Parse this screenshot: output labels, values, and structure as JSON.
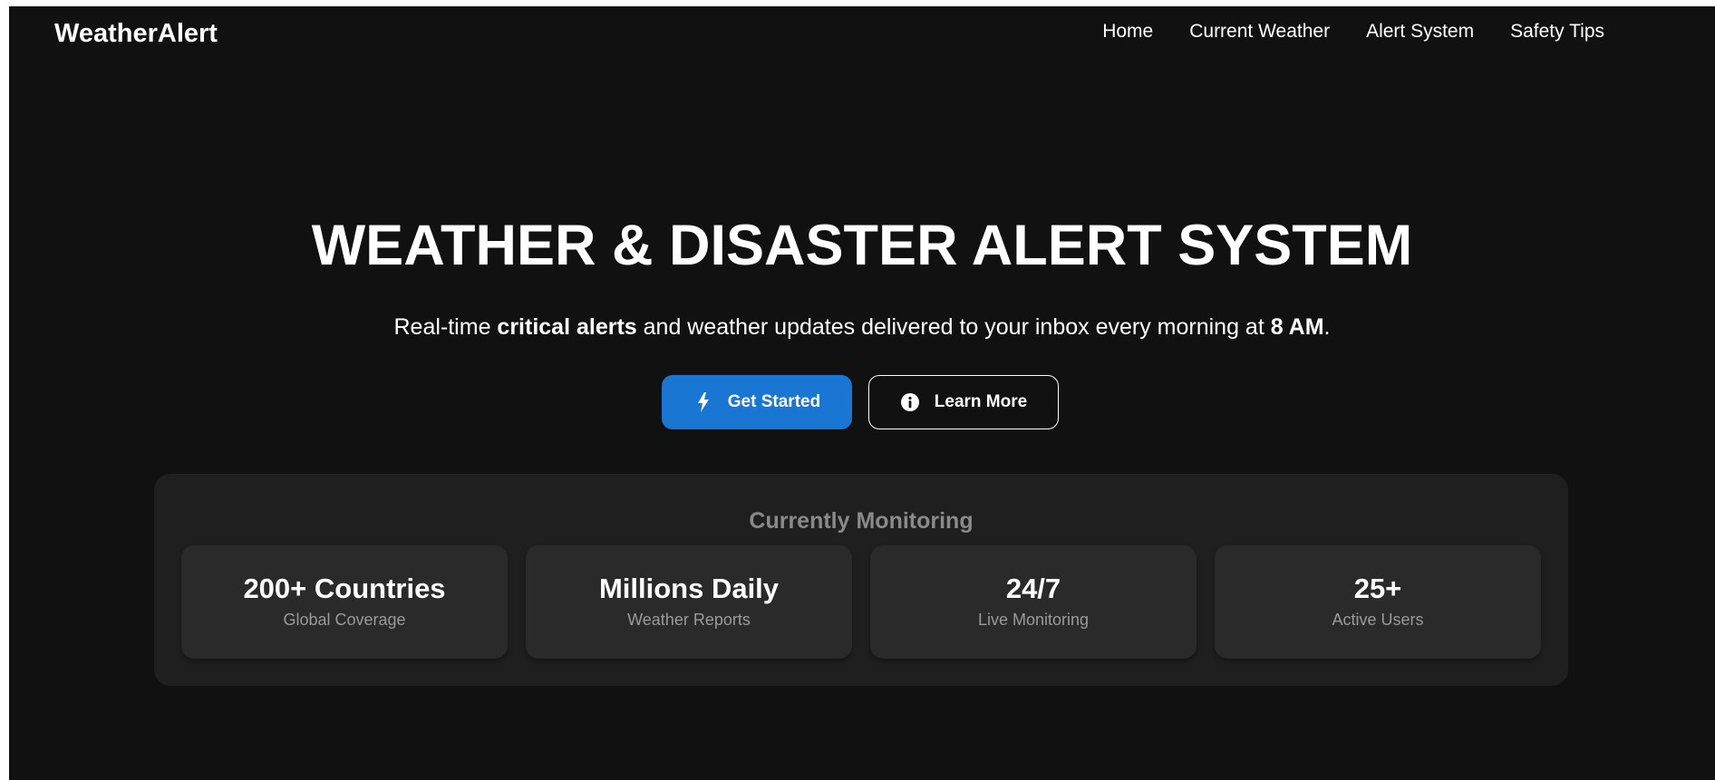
{
  "nav": {
    "logo": "WeatherAlert",
    "links": [
      "Home",
      "Current Weather",
      "Alert System",
      "Safety Tips"
    ]
  },
  "hero": {
    "title": "WEATHER & DISASTER ALERT SYSTEM",
    "subtitle": {
      "part1": "Real-time ",
      "bold1": "critical alerts",
      "part2": " and weather updates delivered to your inbox every morning at ",
      "bold2": "8 AM",
      "part3": "."
    },
    "buttons": {
      "primary": {
        "label": "Get Started",
        "icon": "lightning-icon",
        "color": "#1976d2"
      },
      "secondary": {
        "label": "Learn More",
        "icon": "info-icon"
      }
    }
  },
  "monitoring": {
    "title": "Currently Monitoring",
    "stats": [
      {
        "value": "200+ Countries",
        "label": "Global Coverage"
      },
      {
        "value": "Millions Daily",
        "label": "Weather Reports"
      },
      {
        "value": "24/7",
        "label": "Live Monitoring"
      },
      {
        "value": "25+",
        "label": "Active Users"
      }
    ]
  }
}
